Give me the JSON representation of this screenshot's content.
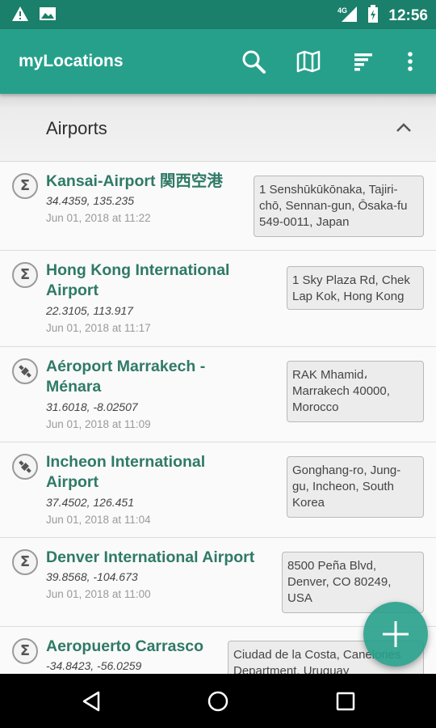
{
  "status_bar": {
    "time": "12:56",
    "network": "4G",
    "icons": [
      "warning-icon",
      "image-notification-icon",
      "signal-icon",
      "battery-icon"
    ]
  },
  "app_bar": {
    "title": "myLocations",
    "actions": [
      "search-icon",
      "map-icon",
      "sort-icon",
      "overflow-menu-icon"
    ]
  },
  "section": {
    "title": "Airports",
    "toggle_icon": "chevron-up-icon"
  },
  "locations": [
    {
      "name": "Kansai-Airport 関西空港",
      "coords": "34.4359, 135.235",
      "date": "Jun 01, 2018 at 11:22",
      "address": "1 Senshūkūkōnaka, Tajiri-\nchō, Sennan-gun, Ōsaka-fu\n549-0011, Japan",
      "icon": "sigma-icon"
    },
    {
      "name": "Hong Kong International\nAirport",
      "coords": "22.3105, 113.917",
      "date": "Jun 01, 2018 at 11:17",
      "address": "1 Sky Plaza Rd, Chek\nLap Kok, Hong Kong",
      "icon": "sigma-icon"
    },
    {
      "name": "Aéroport Marrakech -\nMénara",
      "coords": "31.6018, -8.02507",
      "date": "Jun 01, 2018 at 11:09",
      "address": "RAK Mhamid،\nMarrakech 40000,\nMorocco",
      "icon": "satellite-icon"
    },
    {
      "name": "Incheon International\nAirport",
      "coords": "37.4502, 126.451",
      "date": "Jun 01, 2018 at 11:04",
      "address": "Gonghang-ro, Jung-\ngu, Incheon, South\nKorea",
      "icon": "satellite-icon"
    },
    {
      "name": "Denver International Airport",
      "coords": "39.8568, -104.673",
      "date": "Jun 01, 2018 at 11:00",
      "address": "8500 Peña Blvd,\nDenver, CO 80249,\nUSA",
      "icon": "sigma-icon"
    },
    {
      "name": "Aeropuerto Carrasco",
      "coords": "-34.8423, -56.0259",
      "date": "",
      "address": "Ciudad de la Costa, Canelones\nDepartment, Uruguay",
      "icon": "sigma-icon"
    }
  ],
  "fab": {
    "icon": "add-icon"
  },
  "nav_bar": {
    "icons": [
      "back-icon",
      "home-icon",
      "recents-icon"
    ]
  },
  "colors": {
    "status_bar": "#1a7f6b",
    "app_bar": "#26a08a",
    "accent_text": "#2f7a66",
    "fab": "#26a08a"
  }
}
